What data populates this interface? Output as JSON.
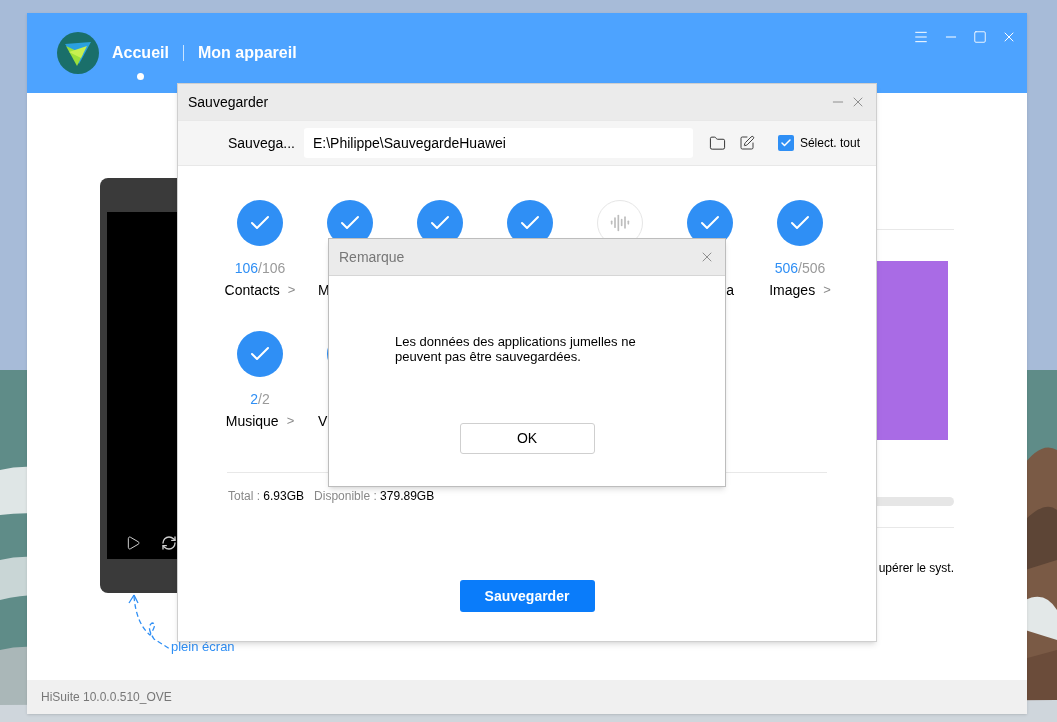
{
  "window": {
    "tabs": [
      {
        "label": "Accueil",
        "selected": true
      },
      {
        "label": "Mon appareil",
        "selected": false
      }
    ],
    "status_bar": "HiSuite 10.0.0.510_OVE"
  },
  "phone_hint": [
    "plein écran"
  ],
  "side_panel": {
    "text": "upérer le syst."
  },
  "backup_dialog": {
    "title": "Sauvegarder",
    "path_label": "Sauvega...",
    "path": "E:\\Philippe\\SauvegardeHuawei",
    "select_all": {
      "label": "Sélect. tout",
      "checked": true
    },
    "categories": [
      {
        "kind": "full",
        "checked": true,
        "done": "106",
        "total": "/106",
        "label": "Contacts",
        "chevron": ">"
      },
      {
        "kind": "covered-left",
        "checked": true,
        "label": "M"
      },
      {
        "kind": "hidden-label",
        "checked": true
      },
      {
        "kind": "hidden-label",
        "checked": true
      },
      {
        "kind": "hidden-label",
        "checked": false
      },
      {
        "kind": "covered-right",
        "checked": true,
        "label": "a"
      },
      {
        "kind": "full",
        "checked": true,
        "done": "506",
        "total": "/506",
        "label": "Images",
        "chevron": ">"
      },
      {
        "kind": "full",
        "checked": true,
        "done": "2",
        "total": "/2",
        "label": "Musique",
        "chevron": ">"
      },
      {
        "kind": "sliver",
        "checked": true,
        "label": "V"
      }
    ],
    "total_label": "Total : ",
    "total": "6.93GB",
    "available_label": "Disponible : ",
    "available": "379.89GB",
    "button": "Sauvegarder"
  },
  "notice_dialog": {
    "title": "Remarque",
    "message": "Les données des applications jumelles ne peuvent pas être sauvegardées.",
    "button": "OK"
  }
}
